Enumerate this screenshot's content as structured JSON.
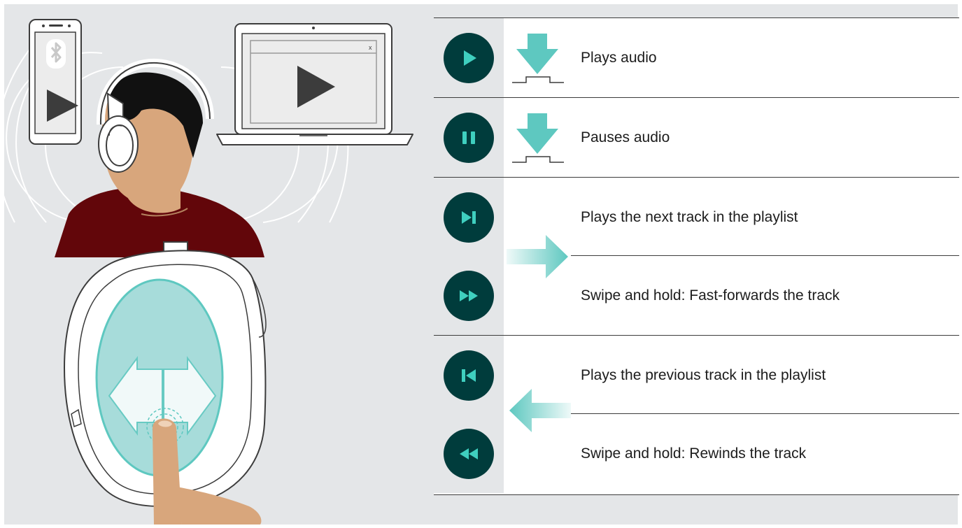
{
  "illustration": {
    "laptop_window_close": "x"
  },
  "colors": {
    "page_background": "#ffffff",
    "panel_background": "#e4e6e8",
    "button_background": "#003c3c",
    "button_icon": "#3fcfbf",
    "gesture_accent": "#5ec8c0",
    "touchpad": "#a7dcda",
    "shirt": "#62060a",
    "skin": "#d8a67c",
    "hair": "#111111"
  },
  "functions": [
    {
      "icon": "play-icon",
      "gesture": "tap",
      "label": "Plays audio"
    },
    {
      "icon": "pause-icon",
      "gesture": "tap",
      "label": "Pauses audio"
    },
    {
      "icon": "next-track-icon",
      "gesture": "swipe-right",
      "label": "Plays the next track in the playlist"
    },
    {
      "icon": "fast-forward-icon",
      "gesture": "swipe-right-hold",
      "label": "Swipe and hold: Fast-forwards the track"
    },
    {
      "icon": "previous-track-icon",
      "gesture": "swipe-left",
      "label": "Plays the previous track in the playlist"
    },
    {
      "icon": "rewind-icon",
      "gesture": "swipe-left-hold",
      "label": "Swipe and hold: Rewinds the track"
    }
  ]
}
